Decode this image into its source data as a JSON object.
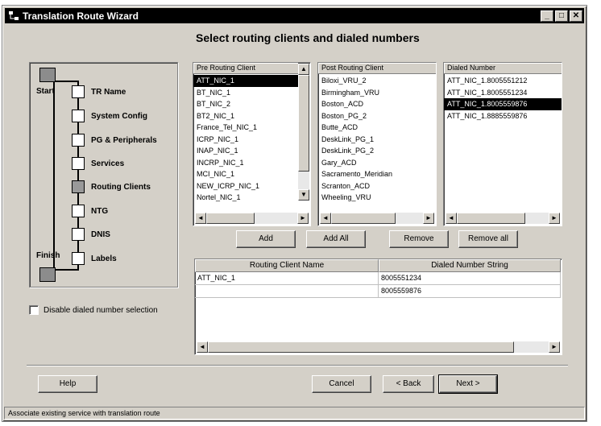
{
  "window": {
    "title": "Translation Route Wizard",
    "icon": "network-icon",
    "controls": [
      "_",
      "□",
      "✕"
    ]
  },
  "heading": "Select routing clients and dialed numbers",
  "steps": [
    {
      "label": "Start",
      "kind": "endpoint"
    },
    {
      "label": "TR Name",
      "kind": "step",
      "state": "done"
    },
    {
      "label": "System Config",
      "kind": "step",
      "state": "done"
    },
    {
      "label": "PG & Peripherals",
      "kind": "step",
      "state": "done"
    },
    {
      "label": "Services",
      "kind": "step",
      "state": "done"
    },
    {
      "label": "Routing Clients",
      "kind": "step",
      "state": "current"
    },
    {
      "label": "NTG",
      "kind": "step",
      "state": "todo"
    },
    {
      "label": "DNIS",
      "kind": "step",
      "state": "todo"
    },
    {
      "label": "Labels",
      "kind": "step",
      "state": "todo"
    },
    {
      "label": "Finish",
      "kind": "endpoint"
    }
  ],
  "disable_checkbox": {
    "label": "Disable dialed number selection",
    "checked": false
  },
  "pre_routing": {
    "header": "Pre Routing Client",
    "items": [
      "ATT_NIC_1",
      "BT_NIC_1",
      "BT_NIC_2",
      "BT2_NIC_1",
      "France_Tel_NIC_1",
      "ICRP_NIC_1",
      "INAP_NIC_1",
      "INCRP_NIC_1",
      "MCI_NIC_1",
      "NEW_ICRP_NIC_1",
      "Nortel_NIC_1"
    ],
    "selected": "ATT_NIC_1"
  },
  "post_routing": {
    "header": "Post Routing Client",
    "items": [
      "Biloxi_VRU_2",
      "Birmingham_VRU",
      "Boston_ACD",
      "Boston_PG_2",
      "Butte_ACD",
      "DeskLink_PG_1",
      "DeskLink_PG_2",
      "Gary_ACD",
      "Sacramento_Meridian",
      "Scranton_ACD",
      "Wheeling_VRU"
    ]
  },
  "dialed_number": {
    "header": "Dialed Number",
    "items": [
      "ATT_NIC_1.8005551212",
      "ATT_NIC_1.8005551234",
      "ATT_NIC_1.8005559876",
      "ATT_NIC_1.8885559876"
    ],
    "selected": "ATT_NIC_1.8005559876"
  },
  "buttons": {
    "add": "Add",
    "add_all": "Add All",
    "remove": "Remove",
    "remove_all": "Remove all",
    "help": "Help",
    "cancel": "Cancel",
    "back": "< Back",
    "next": "Next >"
  },
  "grid": {
    "columns": [
      "Routing Client Name",
      "Dialed Number String"
    ],
    "rows": [
      [
        "ATT_NIC_1",
        "8005551234"
      ],
      [
        "",
        "8005559876"
      ]
    ]
  },
  "status": "Associate existing service with translation route"
}
